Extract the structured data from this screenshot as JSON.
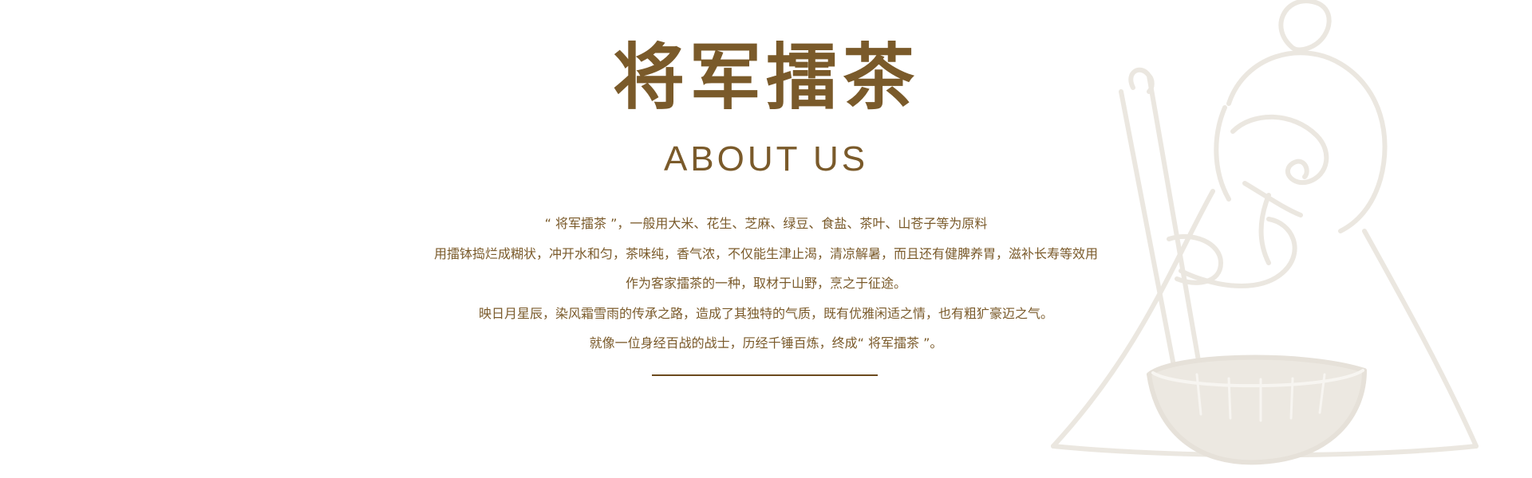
{
  "brand": {
    "title": "将军擂茶",
    "subtitle": "ABOUT  US"
  },
  "description": {
    "lines": [
      "“ 将军擂茶 ”，一般用大米、花生、芝麻、绿豆、食盐、茶叶、山苍子等为原料",
      "用擂钵捣烂成糊状，冲开水和匀，茶味纯，香气浓，不仅能生津止渴，清凉解暑，而且还有健脾养胃，滋补长寿等效用",
      "作为客家擂茶的一种，取材于山野，烹之于征途。",
      "映日月星辰，染风霜雪雨的传承之路，造成了其独特的气质，既有优雅闲适之情，也有粗犷豪迈之气。",
      "就像一位身经百战的战士，历经千锤百炼，终成“ 将军擂茶 ”。"
    ]
  },
  "colors": {
    "text": "#7a5a2a",
    "divider": "#6b4a1d",
    "mascot_stroke": "#ece8e1",
    "mascot_fill": "#f0ede7"
  },
  "icons": {
    "mascot": "tea-grinding-mascot-illustration"
  }
}
